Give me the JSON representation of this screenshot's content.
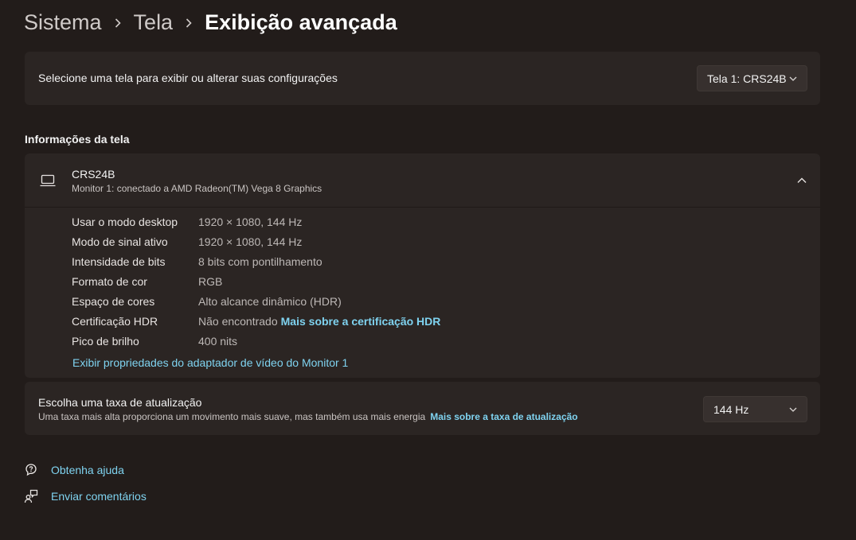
{
  "breadcrumb": {
    "items": [
      "Sistema",
      "Tela"
    ],
    "current": "Exibição avançada"
  },
  "display_select": {
    "label": "Selecione uma tela para exibir ou alterar suas configurações",
    "value": "Tela 1: CRS24B"
  },
  "info": {
    "section_title": "Informações da tela",
    "monitor_name": "CRS24B",
    "monitor_subtitle": "Monitor 1: conectado a AMD Radeon(TM) Vega 8 Graphics",
    "rows": [
      {
        "key": "Usar o modo desktop",
        "value": "1920 × 1080, 144 Hz"
      },
      {
        "key": "Modo de sinal ativo",
        "value": "1920 × 1080, 144 Hz"
      },
      {
        "key": "Intensidade de bits",
        "value": "8 bits com pontilhamento"
      },
      {
        "key": "Formato de cor",
        "value": "RGB"
      },
      {
        "key": "Espaço de cores",
        "value": "Alto alcance dinâmico (HDR)"
      },
      {
        "key": "Certificação HDR",
        "value": "Não encontrado",
        "link": "Mais sobre a certificação HDR"
      },
      {
        "key": "Pico de brilho",
        "value": "400 nits"
      }
    ],
    "adapter_link": "Exibir propriedades do adaptador de vídeo do Monitor 1"
  },
  "refresh": {
    "title": "Escolha uma taxa de atualização",
    "description": "Uma taxa mais alta proporciona um movimento mais suave, mas também usa mais energia",
    "link": "Mais sobre a taxa de atualização",
    "value": "144 Hz"
  },
  "footer": {
    "help": "Obtenha ajuda",
    "feedback": "Enviar comentários"
  },
  "colors": {
    "background": "#221c1a",
    "card": "#2b2523",
    "accent_link": "#7fd3f0"
  },
  "icons": [
    "chevron-right-icon",
    "chevron-down-icon",
    "chevron-up-icon",
    "laptop-icon",
    "help-icon",
    "feedback-icon"
  ]
}
